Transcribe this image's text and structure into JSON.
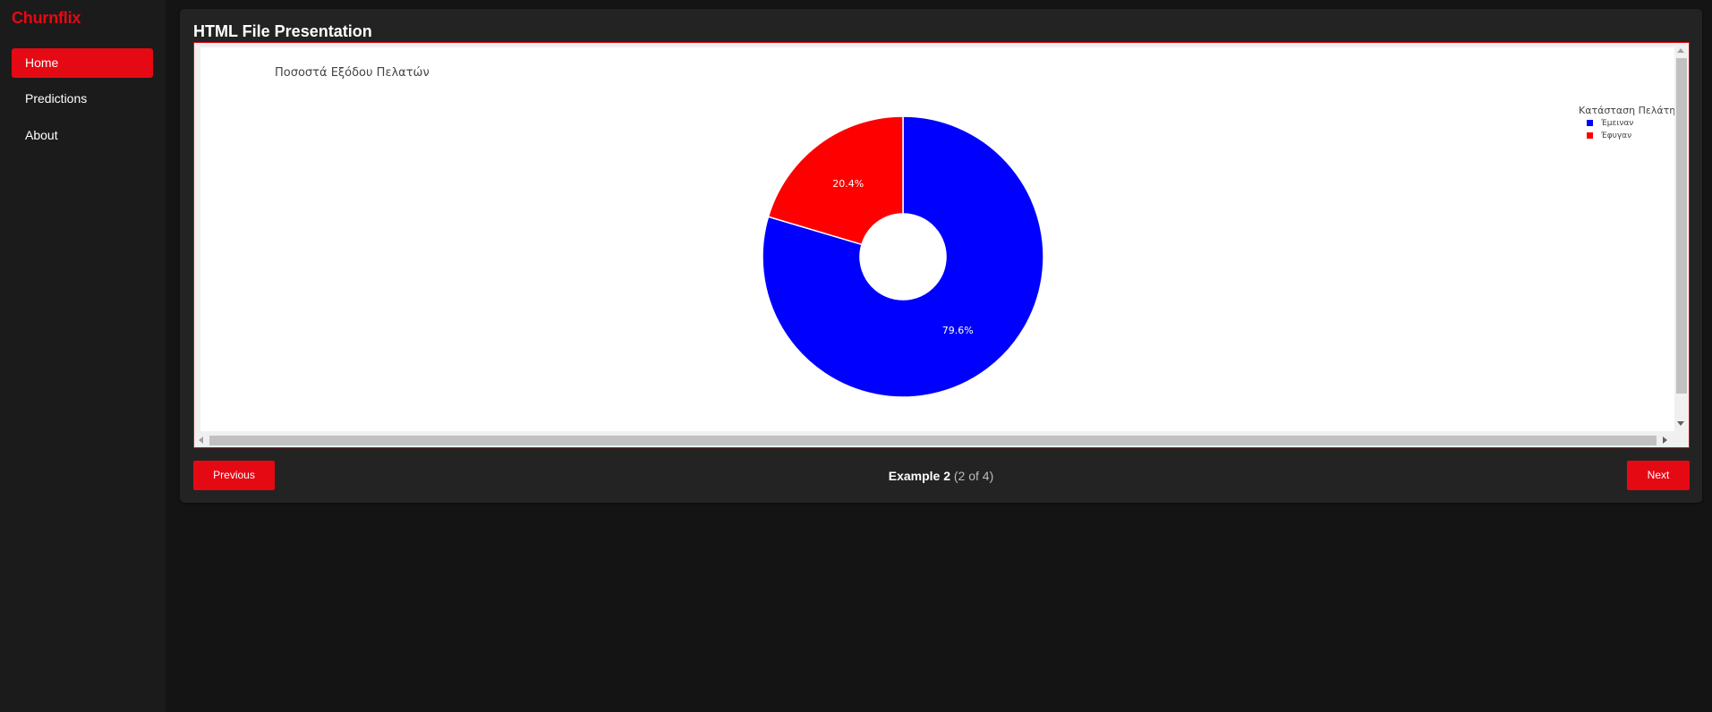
{
  "app": {
    "brand": "Churnflix"
  },
  "sidebar": {
    "items": [
      {
        "label": "Home",
        "active": true
      },
      {
        "label": "Predictions",
        "active": false
      },
      {
        "label": "About",
        "active": false
      }
    ]
  },
  "main": {
    "title": "HTML File Presentation",
    "counter": {
      "label": "Example 2",
      "position": "(2 of 4)"
    },
    "prev_label": "Previous",
    "next_label": "Next"
  },
  "chart_data": {
    "type": "pie",
    "hole": true,
    "title": "Ποσοστά Εξόδου Πελατών",
    "legend_title": "Κατάσταση Πελάτη",
    "legend_position": "top-right",
    "slices": [
      {
        "label": "Έμειναν",
        "value": 79.6,
        "text": "79.6%",
        "color": "#0000ff"
      },
      {
        "label": "Έφυγαν",
        "value": 20.4,
        "text": "20.4%",
        "color": "#ff0000"
      }
    ]
  },
  "colors": {
    "accent": "#e50914"
  }
}
